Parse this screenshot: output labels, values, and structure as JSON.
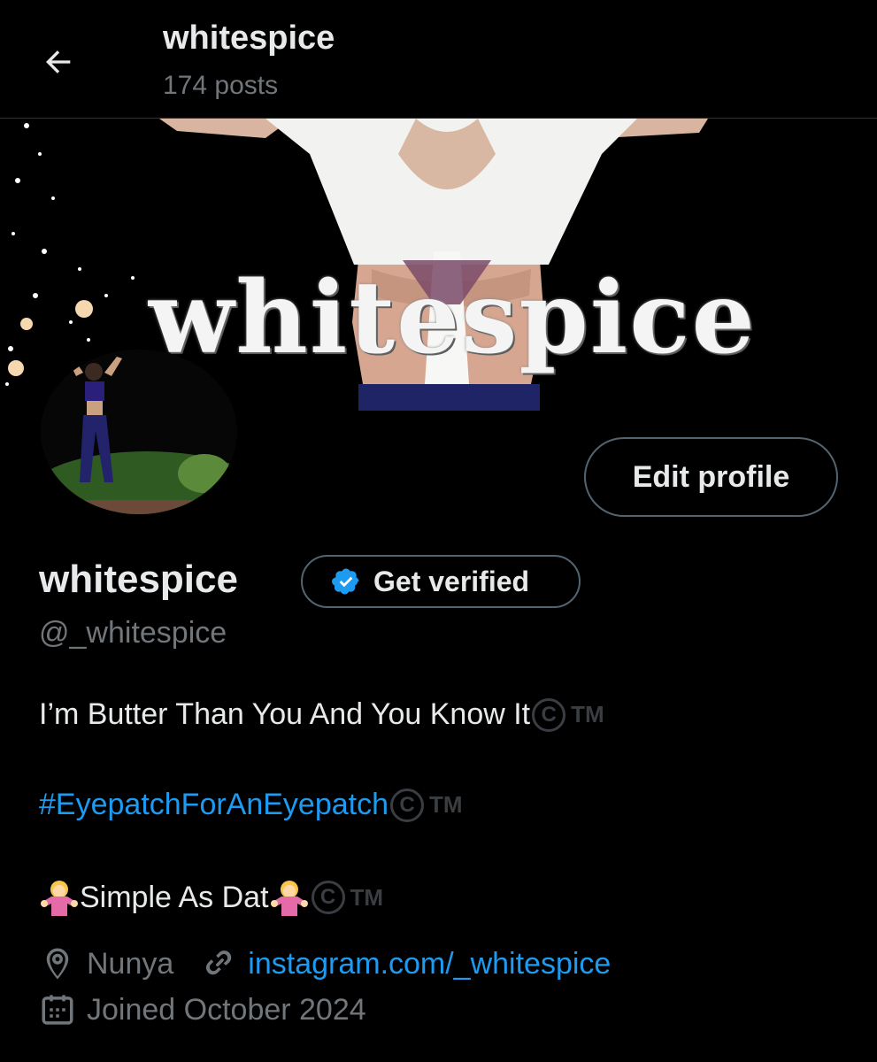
{
  "header": {
    "title": "whitespice",
    "post_count": "174 posts"
  },
  "banner": {
    "logo_text": "whitespice"
  },
  "profile": {
    "edit_label": "Edit profile",
    "display_name": "whitespice",
    "verify_label": "Get verified",
    "handle": "@_whitespice"
  },
  "bio": {
    "line1": "I’m Butter Than You And You Know It",
    "line2": "#EyepatchForAnEyepatch",
    "line3": "Simple As Dat",
    "copyright_symbol": "C",
    "trademark": "TM"
  },
  "meta": {
    "location": "Nunya",
    "website": "instagram.com/_whitespice",
    "joined": "Joined October 2024"
  },
  "colors": {
    "accent": "#1d9bf0",
    "muted": "#71767b",
    "border": "#536471",
    "background": "#000000"
  }
}
